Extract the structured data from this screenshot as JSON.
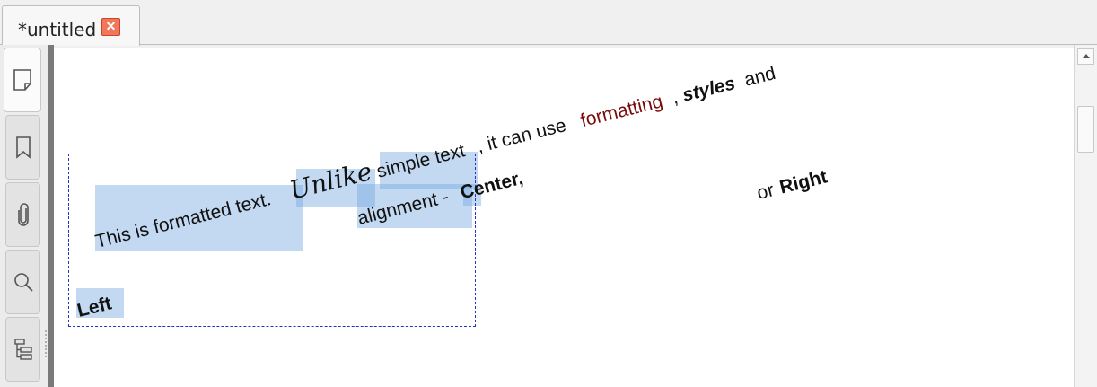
{
  "tab": {
    "title": "*untitled",
    "close_symbol": "✕"
  },
  "sidebar": {
    "buttons": [
      {
        "name": "page-icon"
      },
      {
        "name": "bookmark-icon"
      },
      {
        "name": "attachment-icon"
      },
      {
        "name": "search-icon"
      },
      {
        "name": "tree-icon"
      }
    ]
  },
  "document": {
    "line1": {
      "part1": "This is formatted text.",
      "part2": "Unlike",
      "part3": "simple text",
      "part4": ", it can use",
      "part5": "formatting",
      "part6": ",",
      "part7": "styles",
      "part8": "and"
    },
    "line2": {
      "part1": "alignment -",
      "part2": "Center,",
      "part3": "or",
      "part4": "Right"
    },
    "line3": "Left"
  },
  "colors": {
    "accent_text": "#7a0a0a",
    "selection": "#78aae1",
    "frame_border": "#2233cc"
  }
}
